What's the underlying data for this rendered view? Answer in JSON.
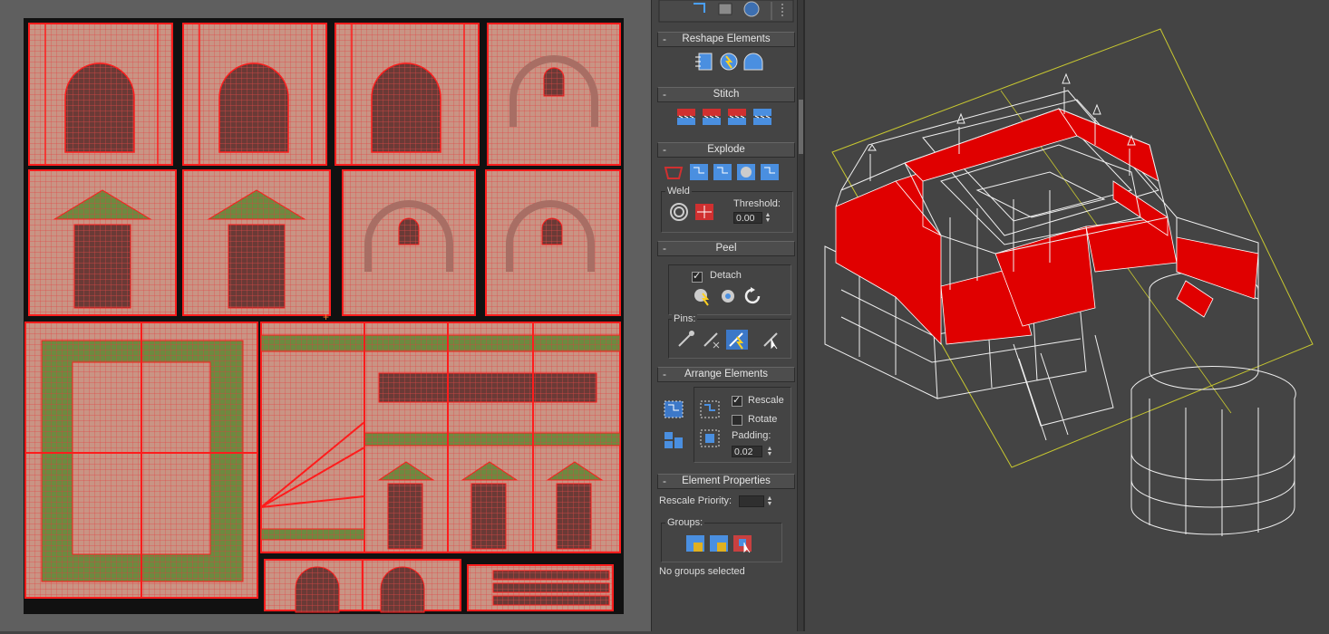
{
  "panel": {
    "reshape": {
      "title": "Reshape Elements"
    },
    "stitch": {
      "title": "Stitch"
    },
    "explode": {
      "title": "Explode",
      "weld_label": "Weld",
      "threshold_label": "Threshold:",
      "threshold_value": "0.00"
    },
    "peel": {
      "title": "Peel",
      "detach_label": "Detach",
      "detach_checked": true,
      "pins_label": "Pins:"
    },
    "arrange": {
      "title": "Arrange Elements",
      "rescale_label": "Rescale",
      "rescale_checked": true,
      "rotate_label": "Rotate",
      "rotate_checked": false,
      "padding_label": "Padding:",
      "padding_value": "0.02"
    },
    "element_props": {
      "title": "Element Properties",
      "rescale_priority_label": "Rescale Priority:",
      "rescale_priority_value": "",
      "groups_label": "Groups:",
      "status": "No groups selected"
    }
  },
  "icons": [
    "reshape-straighten-icon",
    "reshape-relax-icon",
    "reshape-circle-icon",
    "stitch-icon",
    "weld-icon",
    "peel-icon",
    "pin-icon",
    "arrange-icon",
    "group-icon"
  ],
  "colors": {
    "uv_wire": "#ff2020",
    "texture_base": "#c89a8a",
    "grass": "#5a7a2e",
    "viewport_bg": "#444444",
    "selection_red": "#dd0000",
    "bounding_yellow": "#c8c830"
  }
}
